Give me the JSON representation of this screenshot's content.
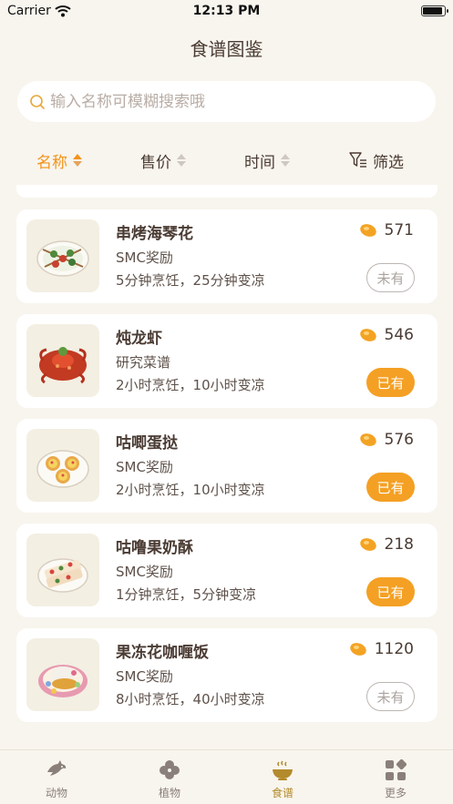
{
  "status_bar": {
    "carrier": "Carrier",
    "time": "12:13 PM"
  },
  "page": {
    "title": "食谱图鉴"
  },
  "search": {
    "placeholder": "输入名称可模糊搜索哦"
  },
  "sort_bar": {
    "name": "名称",
    "price": "售价",
    "time": "时间",
    "filter": "筛选",
    "active": "名称"
  },
  "recipes": [
    {
      "name": "串烤海琴花",
      "source": "SMC奖励",
      "cook_time": "5分钟烹饪，25分钟变凉",
      "price": "571",
      "status": "未有",
      "owned": false
    },
    {
      "name": "炖龙虾",
      "source": "研究菜谱",
      "cook_time": "2小时烹饪，10小时变凉",
      "price": "546",
      "status": "已有",
      "owned": true
    },
    {
      "name": "咕唧蛋挞",
      "source": "SMC奖励",
      "cook_time": "2小时烹饪，10小时变凉",
      "price": "576",
      "status": "已有",
      "owned": true
    },
    {
      "name": "咕噜果奶酥",
      "source": "SMC奖励",
      "cook_time": "1分钟烹饪，5分钟变凉",
      "price": "218",
      "status": "已有",
      "owned": true
    },
    {
      "name": "果冻花咖喱饭",
      "source": "SMC奖励",
      "cook_time": "8小时烹饪，40小时变凉",
      "price": "1120",
      "status": "未有",
      "owned": false
    }
  ],
  "tab_bar": {
    "items": [
      {
        "label": "动物",
        "icon": "fish-icon"
      },
      {
        "label": "植物",
        "icon": "clover-icon"
      },
      {
        "label": "食谱",
        "icon": "bowl-icon"
      },
      {
        "label": "更多",
        "icon": "grid-icon"
      }
    ],
    "active": "食谱"
  },
  "colors": {
    "accent": "#f2931a",
    "owned_badge": "#f4a024",
    "background": "#f8f5ee",
    "active_tab": "#b38a2c"
  }
}
